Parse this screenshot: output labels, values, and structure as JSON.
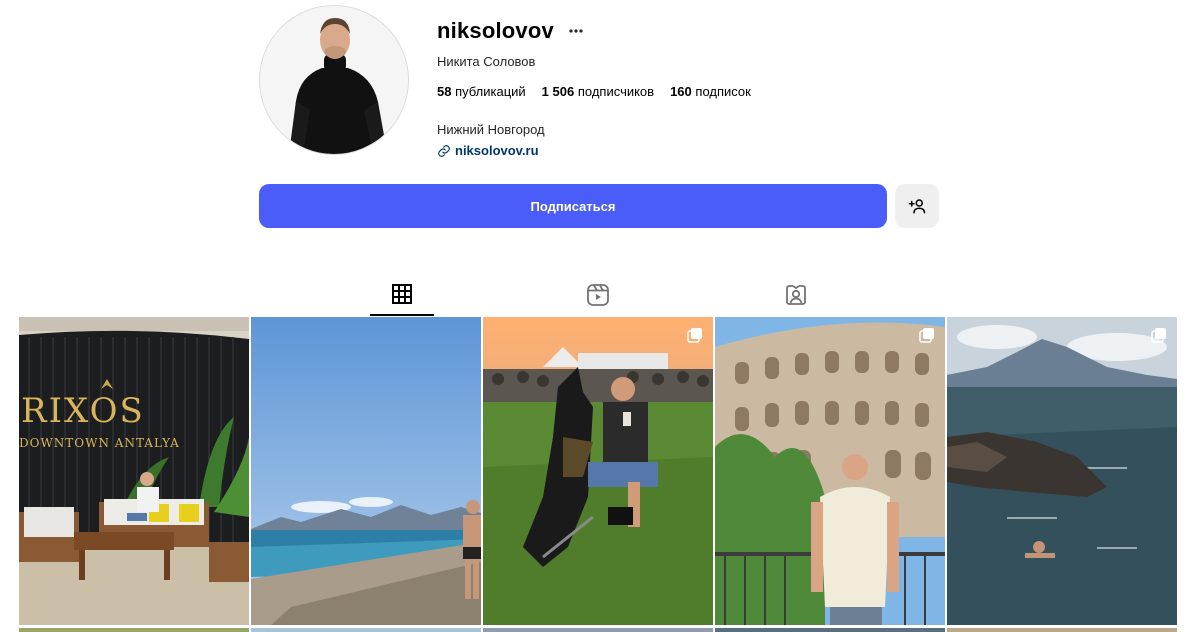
{
  "profile": {
    "username": "niksolovov",
    "full_name": "Никита Соловов",
    "stats": {
      "posts_count": "58",
      "posts_label": "публикаций",
      "followers_count": "1 506",
      "followers_label": "подписчиков",
      "following_count": "160",
      "following_label": "подписок"
    },
    "city": "Нижний Новгород",
    "website": "niksolovov.ru"
  },
  "actions": {
    "follow_label": "Подписаться"
  },
  "tabs": [
    {
      "icon": "grid-icon",
      "active": true
    },
    {
      "icon": "reels-icon",
      "active": false
    },
    {
      "icon": "tagged-icon",
      "active": false
    }
  ],
  "posts": [
    {
      "id": "rixos-lounge",
      "text": "RIXOS",
      "subtext": "DOWNTOWN ANTALYA",
      "carousel": false
    },
    {
      "id": "beach-sea",
      "carousel": false
    },
    {
      "id": "festival-crowd",
      "carousel": true
    },
    {
      "id": "colosseum",
      "carousel": true
    },
    {
      "id": "coast-vesuvius",
      "carousel": true
    }
  ],
  "colors": {
    "accent": "#4a5df9",
    "link": "#00376b",
    "secondary_button_bg": "#efefef"
  }
}
